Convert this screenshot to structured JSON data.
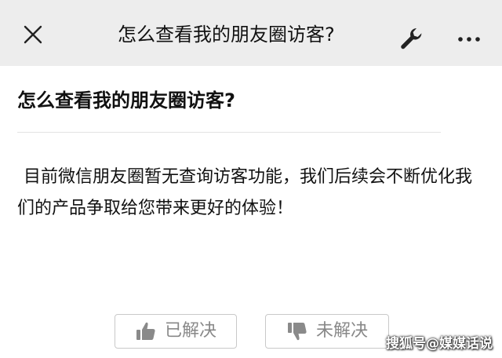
{
  "header": {
    "title": "怎么查看我的朋友圈访客?",
    "close_icon": "close-icon",
    "wrench_icon": "wrench-icon",
    "more_icon": "more-dots-icon",
    "background": "#ededed"
  },
  "article": {
    "question": "怎么查看我的朋友圈访客?",
    "answer": "目前微信朋友圈暂无查询访客功能，我们后续会不断优化我们的产品争取给您带来更好的体验！"
  },
  "feedback": {
    "solved_label": "已解决",
    "solved_icon": "thumbs-up-icon",
    "unsolved_label": "未解决",
    "unsolved_icon": "thumbs-down-icon",
    "icon_color": "#8a8a8a"
  },
  "watermark": {
    "text": "搜狐号@媒媒话说"
  }
}
